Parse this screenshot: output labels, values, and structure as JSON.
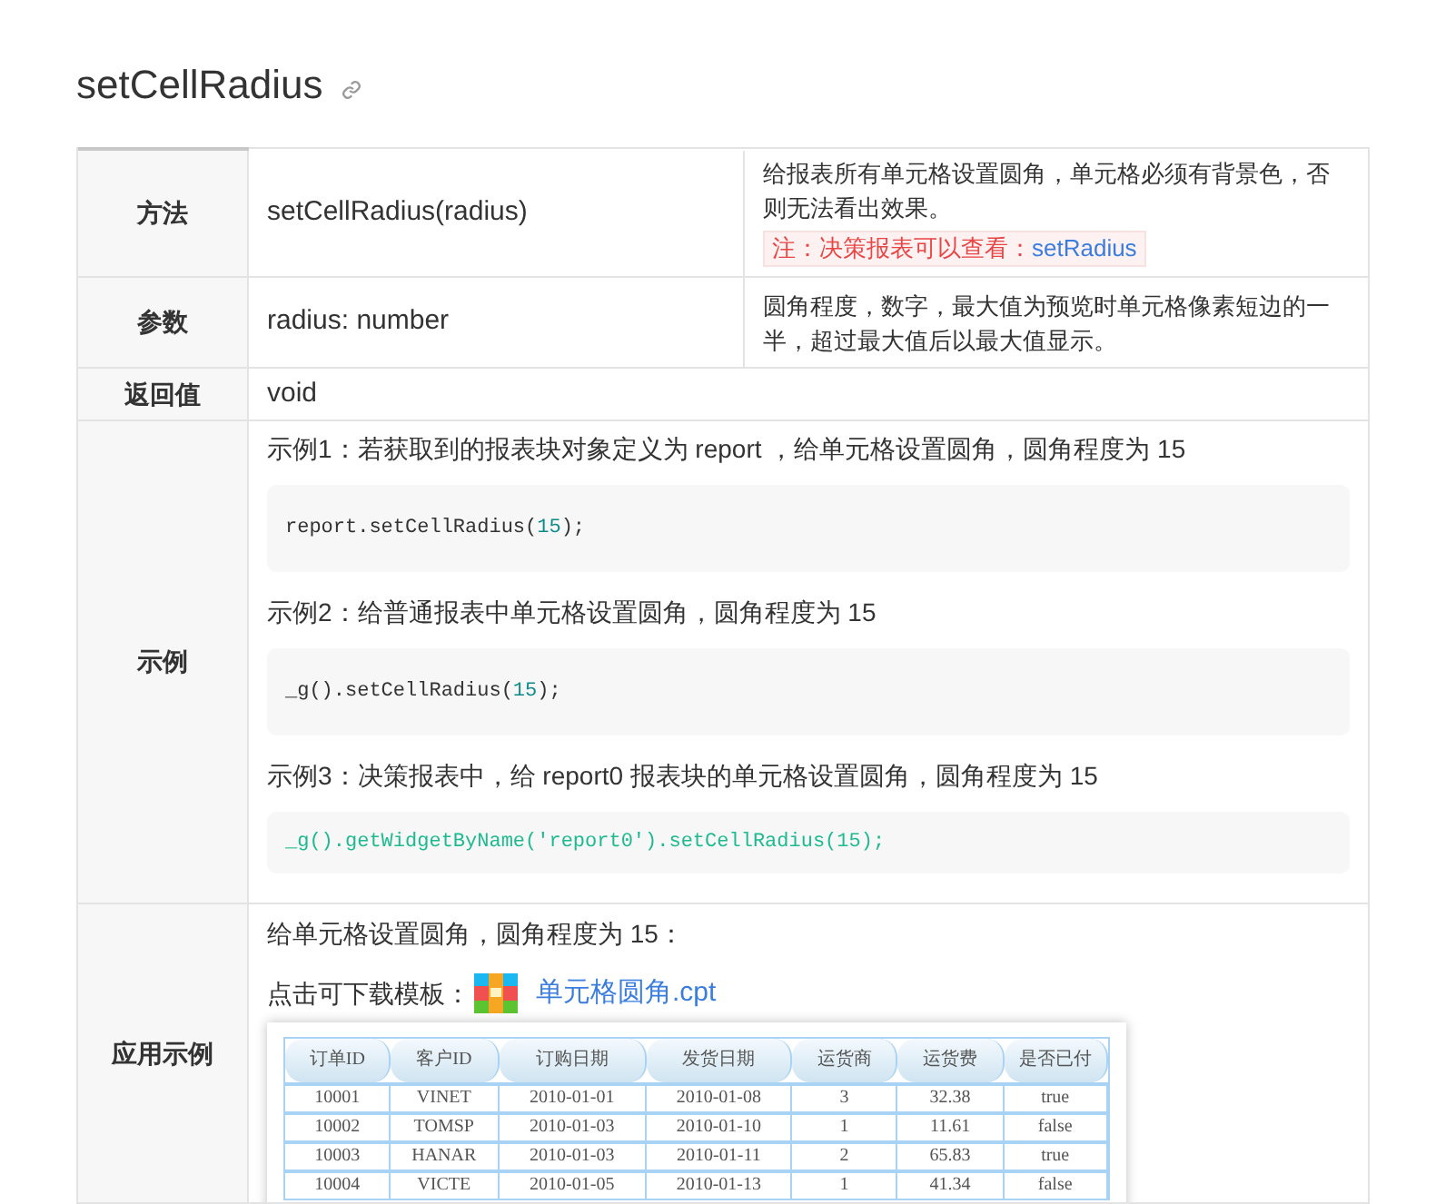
{
  "title": "setCellRadius",
  "rows": [
    {
      "kind": "method",
      "label": "方法",
      "value": "setCellRadius(radius)",
      "description": "给报表所有单元格设置圆角，单元格必须有背景色，否则无法看出效果。",
      "note": {
        "text": "注：决策报表可以查看：",
        "link": "setRadius"
      }
    },
    {
      "kind": "param",
      "label": "参数",
      "value": "radius: number",
      "description": "圆角程度，数字，最大值为预览时单元格像素短边的一半，超过最大值后以最大值显示。"
    },
    {
      "kind": "return",
      "label": "返回值",
      "value": "void"
    },
    {
      "kind": "examples",
      "label": "示例",
      "examples": [
        {
          "caption": "示例1：若获取到的报表块对象定义为 report ，给单元格设置圆角，圆角程度为 15",
          "tokens": [
            {
              "kind": "plain",
              "text": "report.setCellRadius("
            },
            {
              "kind": "number",
              "text": "15"
            },
            {
              "kind": "plain",
              "text": ");"
            }
          ]
        },
        {
          "caption": "示例2：给普通报表中单元格设置圆角，圆角程度为 15",
          "tokens": [
            {
              "kind": "plain",
              "text": "_g().setCellRadius("
            },
            {
              "kind": "number",
              "text": "15"
            },
            {
              "kind": "plain",
              "text": ");"
            }
          ]
        },
        {
          "caption": "示例3：决策报表中，给 report0 报表块的单元格设置圆角，圆角程度为 15",
          "tokens": [
            {
              "kind": "green",
              "text": "_g().getWidgetByName('report0').setCellRadius(15);"
            }
          ]
        }
      ]
    },
    {
      "kind": "demo",
      "label": "应用示例",
      "intro": "给单元格设置圆角，圆角程度为 15：",
      "download_label": "点击可下载模板：",
      "file_link": "单元格圆角.cpt",
      "preview": {
        "columns": [
          "订单ID",
          "客户ID",
          "订购日期",
          "发货日期",
          "运货商",
          "运货费",
          "是否已付"
        ],
        "rows": [
          [
            "10001",
            "VINET",
            "2010-01-01",
            "2010-01-08",
            "3",
            "32.38",
            "true"
          ],
          [
            "10002",
            "TOMSP",
            "2010-01-03",
            "2010-01-10",
            "1",
            "11.61",
            "false"
          ],
          [
            "10003",
            "HANAR",
            "2010-01-03",
            "2010-01-11",
            "2",
            "65.83",
            "true"
          ],
          [
            "10004",
            "VICTE",
            "2010-01-05",
            "2010-01-13",
            "1",
            "41.34",
            "false"
          ]
        ]
      }
    }
  ]
}
